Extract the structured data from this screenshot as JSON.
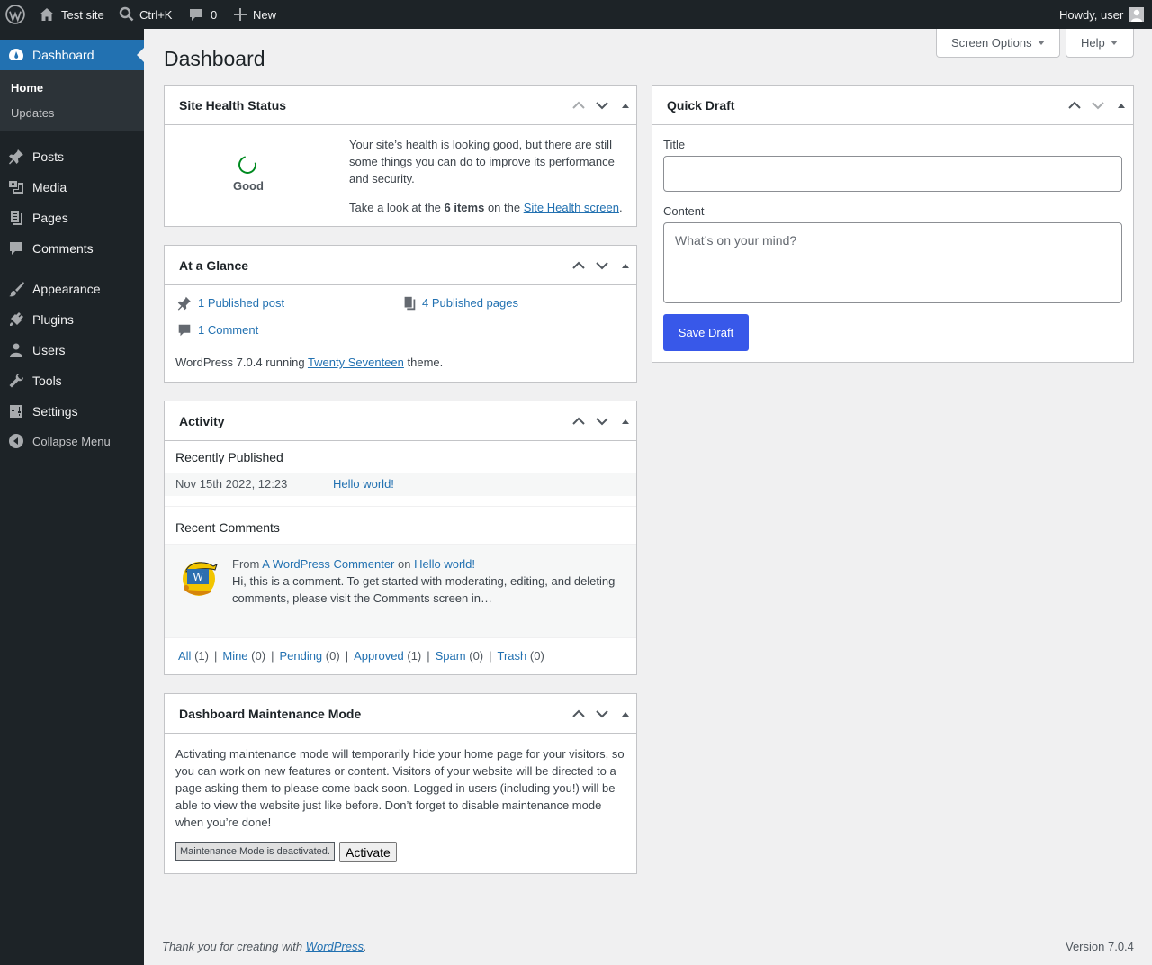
{
  "adminbar": {
    "site_name": "Test site",
    "search_shortcut": "Ctrl+K",
    "comment_count": "0",
    "new_label": "New",
    "howdy": "Howdy, user"
  },
  "sidebar": {
    "dashboard": "Dashboard",
    "sub_home": "Home",
    "sub_updates": "Updates",
    "items": [
      "Posts",
      "Media",
      "Pages",
      "Comments",
      "Appearance",
      "Plugins",
      "Users",
      "Tools",
      "Settings",
      "Collapse Menu"
    ]
  },
  "header": {
    "title": "Dashboard",
    "screen_options": "Screen Options",
    "help": "Help"
  },
  "site_health": {
    "title": "Site Health Status",
    "status": "Good",
    "text1": "Your site’s health is looking good, but there are still some things you can do to improve its performance and security.",
    "text2_pre": "Take a look at the ",
    "items": "6 items",
    "text2_mid": " on the ",
    "link": "Site Health screen",
    "text2_end": "."
  },
  "glance": {
    "title": "At a Glance",
    "posts": "1 Published post",
    "pages": "4 Published pages",
    "comments": "1 Comment",
    "version_pre": "WordPress 7.0.4 running ",
    "theme": "Twenty Seventeen",
    "version_post": " theme."
  },
  "activity": {
    "title": "Activity",
    "recently_published": "Recently Published",
    "pub_date": "Nov 15th 2022, 12:23",
    "pub_title": "Hello world!",
    "recent_comments": "Recent Comments",
    "from": "From",
    "author": "A WordPress Commenter",
    "on": "on",
    "post": "Hello world!",
    "excerpt": "Hi, this is a comment. To get started with moderating, editing, and deleting comments, please visit the Comments screen in…",
    "filters": [
      {
        "label": "All",
        "count": "(1)"
      },
      {
        "label": "Mine",
        "count": "(0)"
      },
      {
        "label": "Pending",
        "count": "(0)"
      },
      {
        "label": "Approved",
        "count": "(1)"
      },
      {
        "label": "Spam",
        "count": "(0)"
      },
      {
        "label": "Trash",
        "count": "(0)"
      }
    ]
  },
  "maintenance": {
    "title": "Dashboard Maintenance Mode",
    "text": "Activating maintenance mode will temporarily hide your home page for your visitors, so you can work on new features or content. Visitors of your website will be directed to a page asking them to please come back soon. Logged in users (including you!) will be able to view the website just like before. Don’t forget to disable maintenance mode when you’re done!",
    "status": "Maintenance Mode is deactivated.",
    "activate": "Activate"
  },
  "quick_draft": {
    "title": "Quick Draft",
    "title_label": "Title",
    "title_value": "",
    "content_label": "Content",
    "content_placeholder": "What’s on your mind?",
    "save": "Save Draft"
  },
  "footer": {
    "thanks_pre": "Thank you for creating with ",
    "wp_link": "WordPress",
    "thanks_post": ".",
    "version": "Version 7.0.4"
  }
}
